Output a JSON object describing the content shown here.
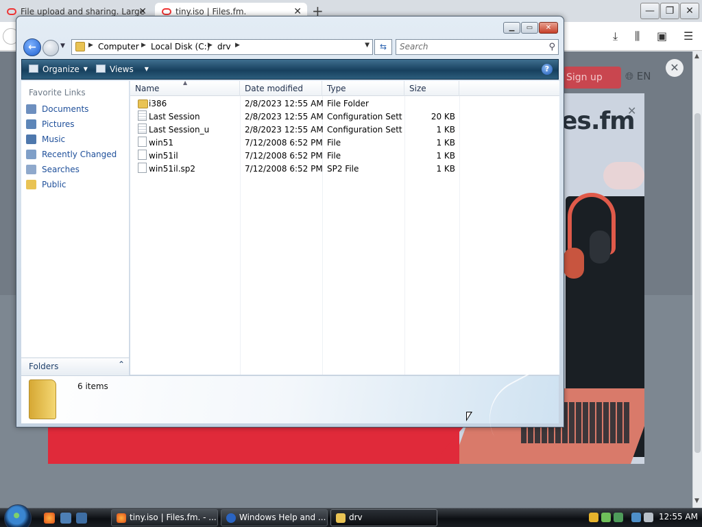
{
  "browser": {
    "tabs": [
      {
        "title": "File upload and sharing. Large",
        "close": "✕"
      },
      {
        "title": "tiny.iso | Files.fm.",
        "close": "✕"
      }
    ],
    "new_tab": "+",
    "window_controls": {
      "minimize": "—",
      "maximize": "❐",
      "close": "✕"
    },
    "page": {
      "signup": "Sign up",
      "language": "EN",
      "close": "✕",
      "brand": "es.fm",
      "modal_close": "✕"
    }
  },
  "explorer": {
    "window_controls": {
      "minimize": "▁",
      "maximize": "▭",
      "close": "✕"
    },
    "breadcrumbs": [
      "Computer",
      "Local Disk (C:)",
      "drv"
    ],
    "search_placeholder": "Search",
    "toolbar": {
      "organize": "Organize",
      "views": "Views",
      "help": "?"
    },
    "nav": {
      "title": "Favorite Links",
      "links": [
        "Documents",
        "Pictures",
        "Music",
        "Recently Changed",
        "Searches",
        "Public"
      ],
      "folders_label": "Folders"
    },
    "columns": [
      "Name",
      "Date modified",
      "Type",
      "Size"
    ],
    "files": [
      {
        "name": "i386",
        "date": "2/8/2023 12:55 AM",
        "type": "File Folder",
        "size": "",
        "icon": "folder-icon"
      },
      {
        "name": "Last Session",
        "date": "2/8/2023 12:55 AM",
        "type": "Configuration Sett...",
        "size": "20 KB",
        "icon": "config-file-icon"
      },
      {
        "name": "Last Session_u",
        "date": "2/8/2023 12:55 AM",
        "type": "Configuration Sett...",
        "size": "1 KB",
        "icon": "config-file-icon"
      },
      {
        "name": "win51",
        "date": "7/12/2008 6:52 PM",
        "type": "File",
        "size": "1 KB",
        "icon": "file-icon"
      },
      {
        "name": "win51il",
        "date": "7/12/2008 6:52 PM",
        "type": "File",
        "size": "1 KB",
        "icon": "file-icon"
      },
      {
        "name": "win51il.sp2",
        "date": "7/12/2008 6:52 PM",
        "type": "SP2 File",
        "size": "1 KB",
        "icon": "file-icon"
      }
    ],
    "status": "6 items"
  },
  "taskbar": {
    "buttons": [
      {
        "label": "tiny.iso | Files.fm. - ...",
        "icon": "firefox-icon"
      },
      {
        "label": "Windows Help and ...",
        "icon": "help-icon"
      },
      {
        "label": "drv",
        "icon": "folder-icon"
      }
    ],
    "clock": "12:55 AM"
  },
  "colors": {
    "accent": "#1d5fcf",
    "link": "#1e4f9a",
    "brand_red": "#e02a3a"
  }
}
